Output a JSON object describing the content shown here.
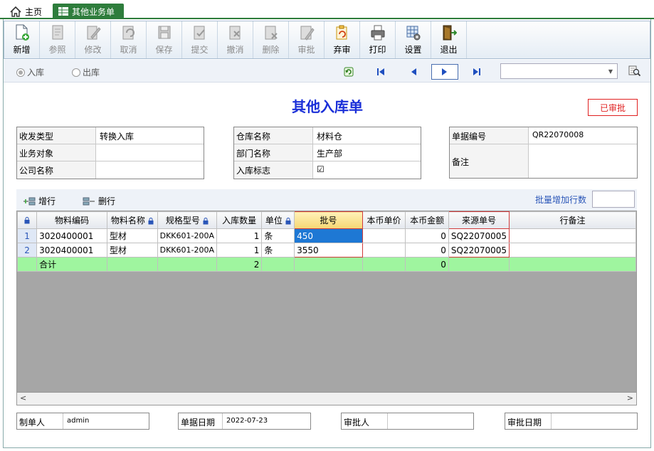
{
  "tabs": {
    "home": "主页",
    "biz": "其他业务单"
  },
  "toolbar": {
    "items": [
      {
        "label": "新增",
        "icon": "new-document-icon",
        "enabled": true
      },
      {
        "label": "参照",
        "icon": "reference-icon",
        "enabled": false
      },
      {
        "label": "修改",
        "icon": "edit-icon",
        "enabled": false
      },
      {
        "label": "取消",
        "icon": "undo-icon",
        "enabled": false
      },
      {
        "label": "保存",
        "icon": "save-icon",
        "enabled": false
      },
      {
        "label": "提交",
        "icon": "submit-icon",
        "enabled": false
      },
      {
        "label": "撤消",
        "icon": "revoke-icon",
        "enabled": false
      },
      {
        "label": "删除",
        "icon": "delete-icon",
        "enabled": false
      },
      {
        "label": "审批",
        "icon": "approve-icon",
        "enabled": false
      },
      {
        "label": "弃审",
        "icon": "unapprove-icon",
        "enabled": true
      },
      {
        "label": "打印",
        "icon": "printer-icon",
        "enabled": true
      },
      {
        "label": "设置",
        "icon": "settings-icon",
        "enabled": true
      },
      {
        "label": "退出",
        "icon": "exit-icon",
        "enabled": true
      }
    ]
  },
  "nav": {
    "radio_in": "入库",
    "radio_out": "出库",
    "search_value": ""
  },
  "title": "其他入库单",
  "status": "已审批",
  "form": {
    "g1": [
      {
        "label": "收发类型",
        "value": "转换入库"
      },
      {
        "label": "业务对象",
        "value": ""
      },
      {
        "label": "公司名称",
        "value": ""
      }
    ],
    "g2": [
      {
        "label": "仓库名称",
        "value": "材料仓"
      },
      {
        "label": "部门名称",
        "value": "生产部"
      },
      {
        "label": "入库标志",
        "value": "☑"
      }
    ],
    "g3": {
      "doc_no_label": "单据编号",
      "doc_no": "QR22070008",
      "remark_label": "备注",
      "remark": ""
    }
  },
  "grid": {
    "add_row": "增行",
    "del_row": "删行",
    "batch_label": "批量增加行数",
    "batch_value": "",
    "columns": [
      "物料编码",
      "物料名称",
      "规格型号",
      "入库数量",
      "单位",
      "批号",
      "本币单价",
      "本币金额",
      "来源单号",
      "行备注"
    ],
    "rows": [
      {
        "no": "1",
        "code": "3020400001",
        "name": "型材",
        "spec": "DKK601-200A",
        "qty": "1",
        "unit": "条",
        "batch": "450",
        "price": "",
        "amount": "0",
        "src": "SQ22070005",
        "note": ""
      },
      {
        "no": "2",
        "code": "3020400001",
        "name": "型材",
        "spec": "DKK601-200A",
        "qty": "1",
        "unit": "条",
        "batch": "3550",
        "price": "",
        "amount": "0",
        "src": "SQ22070005",
        "note": ""
      }
    ],
    "sum": {
      "label": "合计",
      "qty": "2",
      "amount": "0"
    }
  },
  "footer": {
    "maker_label": "制单人",
    "maker": "admin",
    "date_label": "单据日期",
    "date": "2022-07-23",
    "approver_label": "审批人",
    "approver": "",
    "approve_date_label": "审批日期",
    "approve_date": ""
  },
  "colors": {
    "tab_green": "#2e7d3c",
    "title_blue": "#1a2fd8",
    "status_red": "#e02020",
    "sum_green": "#9ff59f"
  }
}
